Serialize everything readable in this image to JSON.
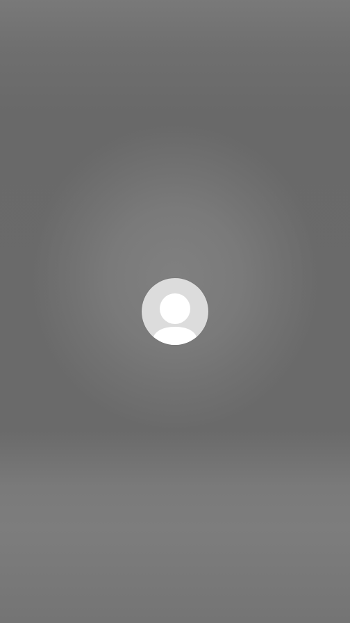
{
  "screen": {
    "avatar": {
      "icon": "user-placeholder-icon",
      "background_color": "#dcdcdc",
      "foreground_color": "#ffffff"
    }
  }
}
